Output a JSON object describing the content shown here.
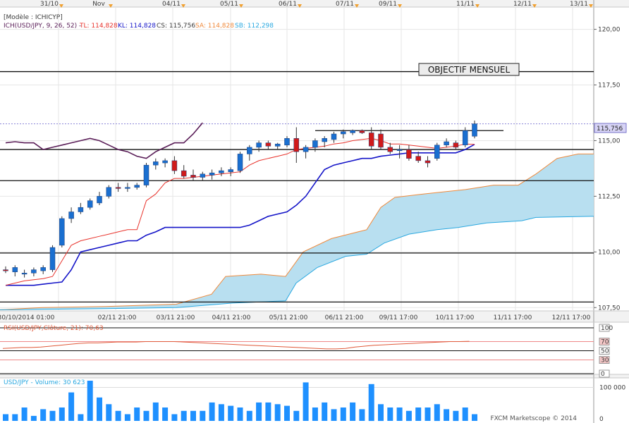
{
  "top_dates": [
    "31/10",
    "Nov",
    "04/11",
    "05/11",
    "06/11",
    "07/11",
    "09/11",
    "11/11",
    "12/11",
    "13/11"
  ],
  "bottom_dates": [
    "30/10/2014 01:00",
    "02/11 21:00",
    "03/11 21:00",
    "04/11 21:00",
    "05/11 21:00",
    "06/11 21:00",
    "09/11 17:00",
    "10/11 17:00",
    "11/11 17:00",
    "12/11 17:00"
  ],
  "model_label": "[Modèle : ICHICYP]",
  "legend": {
    "ich": "ICH(USD/JPY, 9, 26, 52) -",
    "tl": "TL: 114,828",
    "kl": "KL: 114,828",
    "cs": "CS: 115,756",
    "sa": "SA: 114,828",
    "sb": "SB: 112,298"
  },
  "annotation": "OBJECTIF MENSUEL",
  "current_price_label": "115,756",
  "rsi_label": "RSI(USD/JPY,Clôture, 21): 70,63",
  "volume_label": "USD/JPY - Volume: 30 623",
  "watermark": "FXCM Marketscope © 2014",
  "colors": {
    "bull": "#1a6fd0",
    "bear": "#d01a1a",
    "tenkan": "#e8322b",
    "kijun": "#1414c8",
    "chikou": "#5a1e58",
    "senkou_a": "#f08a3c",
    "senkou_b": "#2aa8e0",
    "cloud": "#b8dff0",
    "rsi": "#e05a3a",
    "volume": "#1e90ff"
  },
  "chart_data": {
    "type": "candlestick",
    "title": "USD/JPY",
    "price_axis": {
      "ticks": [
        107.5,
        110,
        112.5,
        115,
        117.5,
        120
      ],
      "tick_labels": [
        "107,50",
        "110,00",
        "112,50",
        "115,00",
        "117,50",
        "120,00"
      ],
      "ylim": [
        107.35,
        121.0
      ]
    },
    "horizontal_levels": [
      118.1,
      114.6,
      113.2,
      109.95,
      107.75
    ],
    "resistance_segment": {
      "y": 115.45
    },
    "candles": [
      {
        "o": 109.2,
        "h": 109.35,
        "l": 109.05,
        "c": 109.15
      },
      {
        "o": 109.1,
        "h": 109.4,
        "l": 108.9,
        "c": 109.3
      },
      {
        "o": 109.0,
        "h": 109.2,
        "l": 108.85,
        "c": 109.05
      },
      {
        "o": 109.05,
        "h": 109.3,
        "l": 108.9,
        "c": 109.2
      },
      {
        "o": 109.15,
        "h": 109.4,
        "l": 109.0,
        "c": 109.3
      },
      {
        "o": 109.2,
        "h": 110.3,
        "l": 109.1,
        "c": 110.2
      },
      {
        "o": 110.3,
        "h": 111.6,
        "l": 110.2,
        "c": 111.5
      },
      {
        "o": 111.5,
        "h": 112.0,
        "l": 111.3,
        "c": 111.8
      },
      {
        "o": 111.8,
        "h": 112.2,
        "l": 111.7,
        "c": 112.0
      },
      {
        "o": 112.0,
        "h": 112.4,
        "l": 111.9,
        "c": 112.3
      },
      {
        "o": 112.2,
        "h": 112.7,
        "l": 112.1,
        "c": 112.5
      },
      {
        "o": 112.5,
        "h": 113.0,
        "l": 112.4,
        "c": 112.9
      },
      {
        "o": 112.9,
        "h": 113.1,
        "l": 112.7,
        "c": 112.85
      },
      {
        "o": 112.85,
        "h": 113.1,
        "l": 112.7,
        "c": 112.9
      },
      {
        "o": 112.9,
        "h": 113.1,
        "l": 112.8,
        "c": 113.0
      },
      {
        "o": 113.0,
        "h": 114.0,
        "l": 112.9,
        "c": 113.9
      },
      {
        "o": 113.9,
        "h": 114.2,
        "l": 113.7,
        "c": 114.05
      },
      {
        "o": 114.0,
        "h": 114.2,
        "l": 113.8,
        "c": 114.1
      },
      {
        "o": 114.1,
        "h": 114.3,
        "l": 113.5,
        "c": 113.65
      },
      {
        "o": 113.65,
        "h": 113.9,
        "l": 113.3,
        "c": 113.4
      },
      {
        "o": 113.45,
        "h": 113.7,
        "l": 113.2,
        "c": 113.35
      },
      {
        "o": 113.35,
        "h": 113.6,
        "l": 113.2,
        "c": 113.5
      },
      {
        "o": 113.45,
        "h": 113.7,
        "l": 113.25,
        "c": 113.55
      },
      {
        "o": 113.55,
        "h": 113.8,
        "l": 113.4,
        "c": 113.65
      },
      {
        "o": 113.6,
        "h": 113.8,
        "l": 113.4,
        "c": 113.7
      },
      {
        "o": 113.65,
        "h": 114.5,
        "l": 113.55,
        "c": 114.4
      },
      {
        "o": 114.4,
        "h": 114.8,
        "l": 114.1,
        "c": 114.7
      },
      {
        "o": 114.7,
        "h": 115.0,
        "l": 114.5,
        "c": 114.9
      },
      {
        "o": 114.9,
        "h": 115.0,
        "l": 114.6,
        "c": 114.75
      },
      {
        "o": 114.75,
        "h": 114.9,
        "l": 114.6,
        "c": 114.85
      },
      {
        "o": 114.8,
        "h": 115.2,
        "l": 114.7,
        "c": 115.1
      },
      {
        "o": 115.1,
        "h": 115.6,
        "l": 114.0,
        "c": 114.5
      },
      {
        "o": 114.5,
        "h": 114.8,
        "l": 114.2,
        "c": 114.7
      },
      {
        "o": 114.7,
        "h": 115.1,
        "l": 114.5,
        "c": 115.0
      },
      {
        "o": 114.95,
        "h": 115.2,
        "l": 114.7,
        "c": 115.1
      },
      {
        "o": 115.05,
        "h": 115.4,
        "l": 114.9,
        "c": 115.3
      },
      {
        "o": 115.3,
        "h": 115.5,
        "l": 115.1,
        "c": 115.4
      },
      {
        "o": 115.35,
        "h": 115.5,
        "l": 115.25,
        "c": 115.45
      },
      {
        "o": 115.45,
        "h": 115.5,
        "l": 115.3,
        "c": 115.35
      },
      {
        "o": 115.35,
        "h": 115.6,
        "l": 114.6,
        "c": 114.75
      },
      {
        "o": 115.3,
        "h": 115.5,
        "l": 114.6,
        "c": 114.7
      },
      {
        "o": 114.7,
        "h": 114.9,
        "l": 114.4,
        "c": 114.5
      },
      {
        "o": 114.55,
        "h": 114.8,
        "l": 114.2,
        "c": 114.6
      },
      {
        "o": 114.6,
        "h": 114.8,
        "l": 114.1,
        "c": 114.2
      },
      {
        "o": 114.3,
        "h": 114.5,
        "l": 114.0,
        "c": 114.1
      },
      {
        "o": 114.1,
        "h": 114.3,
        "l": 113.8,
        "c": 114.0
      },
      {
        "o": 114.2,
        "h": 114.9,
        "l": 114.1,
        "c": 114.8
      },
      {
        "o": 114.8,
        "h": 115.1,
        "l": 114.7,
        "c": 114.95
      },
      {
        "o": 114.9,
        "h": 115.0,
        "l": 114.6,
        "c": 114.7
      },
      {
        "o": 114.8,
        "h": 115.6,
        "l": 114.7,
        "c": 115.45
      },
      {
        "o": 115.2,
        "h": 115.9,
        "l": 115.1,
        "c": 115.756
      }
    ],
    "series": [
      {
        "name": "TL",
        "values": [
          108.5,
          108.6,
          108.7,
          108.75,
          108.8,
          108.9,
          109.6,
          110.3,
          110.5,
          110.6,
          110.7,
          110.8,
          110.9,
          111.0,
          111.0,
          112.3,
          112.6,
          113.1,
          113.3,
          113.3,
          113.35,
          113.4,
          113.45,
          113.5,
          113.55,
          113.6,
          113.9,
          114.1,
          114.2,
          114.3,
          114.4,
          114.6,
          114.65,
          114.7,
          114.75,
          114.85,
          114.9,
          115.0,
          115.05,
          115.1,
          115.0,
          114.85,
          114.85,
          114.8,
          114.75,
          114.7,
          114.65,
          114.7,
          114.75,
          114.85,
          114.83
        ]
      },
      {
        "name": "KL",
        "values": [
          108.5,
          108.5,
          108.5,
          108.5,
          108.55,
          108.6,
          108.65,
          109.2,
          110.0,
          110.1,
          110.2,
          110.3,
          110.4,
          110.5,
          110.5,
          110.75,
          110.9,
          111.1,
          111.1,
          111.1,
          111.1,
          111.1,
          111.1,
          111.1,
          111.1,
          111.1,
          111.2,
          111.4,
          111.6,
          111.7,
          111.8,
          112.1,
          112.5,
          113.1,
          113.7,
          113.9,
          114.0,
          114.1,
          114.2,
          114.2,
          114.3,
          114.35,
          114.4,
          114.45,
          114.45,
          114.45,
          114.45,
          114.45,
          114.45,
          114.6,
          114.83
        ]
      },
      {
        "name": "CS",
        "values": [
          114.9,
          114.95,
          114.9,
          114.9,
          114.6,
          114.7,
          114.8,
          114.9,
          115.0,
          115.1,
          115.0,
          114.8,
          114.6,
          114.5,
          114.3,
          114.2,
          114.5,
          114.7,
          114.9,
          114.9,
          115.3,
          115.8
        ]
      }
    ]
  },
  "rsi": {
    "ticks": [
      100,
      70,
      50,
      30,
      0
    ],
    "ylim": [
      0,
      100
    ]
  },
  "volume": {
    "tick_labels": [
      "100 000",
      "0"
    ],
    "ylim": [
      0,
      120000
    ]
  }
}
